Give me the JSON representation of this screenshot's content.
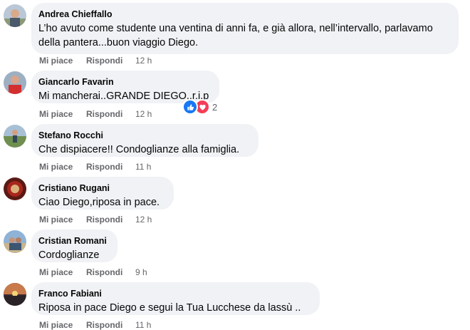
{
  "actions": {
    "like_label": "Mi piace",
    "reply_label": "Rispondi"
  },
  "comments": [
    {
      "author": "Andrea Chieffallo",
      "text": "L’ho avuto come studente una ventina di anni fa, e già allora, nell’intervallo, parlavamo della pantera...buon viaggio Diego.",
      "time": "12 h"
    },
    {
      "author": "Giancarlo Favarin",
      "text": "Mi mancherai..GRANDE DIEGO..r.i.p",
      "time": "12 h",
      "reactions": {
        "icons": [
          "like-icon",
          "love-icon"
        ],
        "count": "2"
      }
    },
    {
      "author": "Stefano Rocchi",
      "text": "Che dispiacere!! Condoglianze alla famiglia.",
      "time": "11 h"
    },
    {
      "author": "Cristiano Rugani",
      "text": "Ciao Diego,riposa in pace.",
      "time": "12 h"
    },
    {
      "author": "Cristian Romani",
      "text": "Cordoglianze",
      "time": "9 h"
    },
    {
      "author": "Franco Fabiani",
      "text": "Riposa in pace Diego e segui la Tua Lucchese da lassù ..",
      "time": "11 h"
    }
  ],
  "colors": {
    "bubble": "#f0f2f5",
    "meta": "#65676b",
    "like_reaction": "#1877f2",
    "love_reaction": "#f33e58"
  }
}
